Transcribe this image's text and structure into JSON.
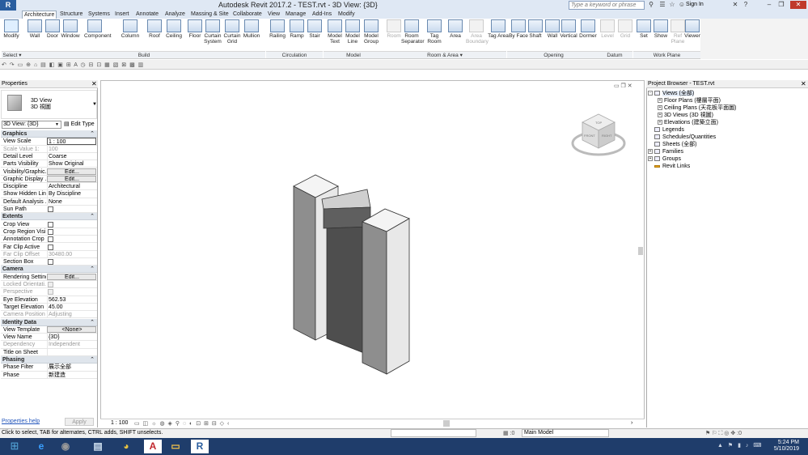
{
  "app": {
    "title": "Autodesk Revit 2017.2 -     TEST.rvt - 3D View: {3D}",
    "logo": "R"
  },
  "titlebar": {
    "search_placeholder": "Type a keyword or phrase",
    "sign_in": "Sign In"
  },
  "tabs": [
    "Architecture",
    "Structure",
    "Systems",
    "Insert",
    "Annotate",
    "Analyze",
    "Massing & Site",
    "Collaborate",
    "View",
    "Manage",
    "Add-Ins",
    "Modify"
  ],
  "ribbon": {
    "buttons": [
      {
        "name": "modify",
        "label": "Modify",
        "icon": "arrow-icon"
      },
      {
        "name": "wall",
        "label": "Wall",
        "icon": "wall-icon"
      },
      {
        "name": "door",
        "label": "Door",
        "icon": "door-icon"
      },
      {
        "name": "window",
        "label": "Window",
        "icon": "window-icon"
      },
      {
        "name": "component",
        "label": "Component",
        "icon": "component-icon"
      },
      {
        "name": "column",
        "label": "Column",
        "icon": "column-icon"
      },
      {
        "name": "roof",
        "label": "Roof",
        "icon": "roof-icon"
      },
      {
        "name": "ceiling",
        "label": "Ceiling",
        "icon": "ceiling-icon"
      },
      {
        "name": "floor",
        "label": "Floor",
        "icon": "floor-icon"
      },
      {
        "name": "curtain-system",
        "label": "Curtain System",
        "icon": "curtain-system-icon"
      },
      {
        "name": "curtain-grid",
        "label": "Curtain Grid",
        "icon": "curtain-grid-icon"
      },
      {
        "name": "mullion",
        "label": "Mullion",
        "icon": "mullion-icon"
      },
      {
        "name": "railing",
        "label": "Railing",
        "icon": "railing-icon"
      },
      {
        "name": "ramp",
        "label": "Ramp",
        "icon": "ramp-icon"
      },
      {
        "name": "stair",
        "label": "Stair",
        "icon": "stair-icon"
      },
      {
        "name": "model-text",
        "label": "Model Text",
        "icon": "model-text-icon"
      },
      {
        "name": "model-line",
        "label": "Model Line",
        "icon": "model-line-icon"
      },
      {
        "name": "model-group",
        "label": "Model Group",
        "icon": "model-group-icon"
      },
      {
        "name": "room",
        "label": "Room",
        "icon": "room-icon",
        "disabled": true
      },
      {
        "name": "room-separator",
        "label": "Room Separator",
        "icon": "room-separator-icon"
      },
      {
        "name": "tag-room",
        "label": "Tag Room",
        "icon": "tag-room-icon"
      },
      {
        "name": "area",
        "label": "Area",
        "icon": "area-icon"
      },
      {
        "name": "area-boundary",
        "label": "Area Boundary",
        "icon": "area-boundary-icon",
        "disabled": true
      },
      {
        "name": "tag-area",
        "label": "Tag Area",
        "icon": "tag-area-icon"
      },
      {
        "name": "by-face",
        "label": "By Face",
        "icon": "by-face-icon"
      },
      {
        "name": "shaft",
        "label": "Shaft",
        "icon": "shaft-icon"
      },
      {
        "name": "wall-opening",
        "label": "Wall",
        "icon": "wall-opening-icon"
      },
      {
        "name": "vertical",
        "label": "Vertical",
        "icon": "vertical-icon"
      },
      {
        "name": "dormer",
        "label": "Dormer",
        "icon": "dormer-icon"
      },
      {
        "name": "level",
        "label": "Level",
        "icon": "level-icon",
        "disabled": true
      },
      {
        "name": "grid",
        "label": "Grid",
        "icon": "grid-icon",
        "disabled": true
      },
      {
        "name": "set",
        "label": "Set",
        "icon": "set-icon"
      },
      {
        "name": "show",
        "label": "Show",
        "icon": "show-icon"
      },
      {
        "name": "ref-plane",
        "label": "Ref Plane",
        "icon": "ref-plane-icon",
        "disabled": true
      },
      {
        "name": "viewer",
        "label": "Viewer",
        "icon": "viewer-icon"
      }
    ],
    "panels": [
      "Build",
      "Circulation",
      "Model",
      "Room & Area ▾",
      "Opening",
      "Datum",
      "Work Plane"
    ],
    "select_label": "Select ▾"
  },
  "properties": {
    "title": "Properties",
    "type_name": "3D View",
    "type_sub": "3D 視圖",
    "view_selector": "3D View: {3D}",
    "edit_type": "Edit Type",
    "sections": [
      {
        "title": "Graphics",
        "rows": [
          {
            "label": "View Scale",
            "value": "1 : 100",
            "kind": "box"
          },
          {
            "label": "Scale Value    1:",
            "value": "100",
            "dim": true
          },
          {
            "label": "Detail Level",
            "value": "Coarse"
          },
          {
            "label": "Parts Visibility",
            "value": "Show Original"
          },
          {
            "label": "Visibility/Graphic...",
            "value": "Edit...",
            "kind": "button"
          },
          {
            "label": "Graphic Display ...",
            "value": "Edit...",
            "kind": "button"
          },
          {
            "label": "Discipline",
            "value": "Architectural"
          },
          {
            "label": "Show Hidden Lin...",
            "value": "By Discipline"
          },
          {
            "label": "Default Analysis ...",
            "value": "None"
          },
          {
            "label": "Sun Path",
            "value": "",
            "kind": "check"
          }
        ]
      },
      {
        "title": "Extents",
        "rows": [
          {
            "label": "Crop View",
            "value": "",
            "kind": "check"
          },
          {
            "label": "Crop Region Visi...",
            "value": "",
            "kind": "check"
          },
          {
            "label": "Annotation Crop",
            "value": "",
            "kind": "check"
          },
          {
            "label": "Far Clip Active",
            "value": "",
            "kind": "check"
          },
          {
            "label": "Far Clip Offset",
            "value": "30480.00",
            "dim": true
          },
          {
            "label": "Section Box",
            "value": "",
            "kind": "check"
          }
        ]
      },
      {
        "title": "Camera",
        "rows": [
          {
            "label": "Rendering Settings",
            "value": "Edit...",
            "kind": "button"
          },
          {
            "label": "Locked Orientati...",
            "value": "",
            "kind": "check",
            "dim": true
          },
          {
            "label": "Perspective",
            "value": "",
            "kind": "check",
            "dim": true
          },
          {
            "label": "Eye Elevation",
            "value": "562.53"
          },
          {
            "label": "Target Elevation",
            "value": "45.00"
          },
          {
            "label": "Camera Position",
            "value": "Adjusting",
            "dim": true
          }
        ]
      },
      {
        "title": "Identity Data",
        "rows": [
          {
            "label": "View Template",
            "value": "<None>",
            "kind": "button"
          },
          {
            "label": "View Name",
            "value": "{3D}"
          },
          {
            "label": "Dependency",
            "value": "Independent",
            "dim": true
          },
          {
            "label": "Title on Sheet",
            "value": ""
          }
        ]
      },
      {
        "title": "Phasing",
        "rows": [
          {
            "label": "Phase Filter",
            "value": "展示全部"
          },
          {
            "label": "Phase",
            "value": "新建造"
          }
        ]
      }
    ],
    "help_link": "Properties help",
    "apply": "Apply"
  },
  "canvas": {
    "scale": "1 : 100",
    "viewcube_faces": [
      "TOP",
      "FRONT",
      "RIGHT"
    ]
  },
  "browser": {
    "title": "Project Browser - TEST.rvt",
    "tree": [
      {
        "label": "Views (全部)",
        "level": 0,
        "exp": "-",
        "icon": "views-icon",
        "highlight": true
      },
      {
        "label": "Floor Plans (樓層平面)",
        "level": 1,
        "exp": "+"
      },
      {
        "label": "Ceiling Plans (天花板平面圖)",
        "level": 1,
        "exp": "+"
      },
      {
        "label": "3D Views (3D 視圖)",
        "level": 1,
        "exp": "+"
      },
      {
        "label": "Elevations (建築立面)",
        "level": 1,
        "exp": "+"
      },
      {
        "label": "Legends",
        "level": 0,
        "exp": "",
        "icon": "legends-icon"
      },
      {
        "label": "Schedules/Quantities",
        "level": 0,
        "exp": "",
        "icon": "schedules-icon"
      },
      {
        "label": "Sheets (全部)",
        "level": 0,
        "exp": "",
        "icon": "sheets-icon"
      },
      {
        "label": "Families",
        "level": 0,
        "exp": "+",
        "icon": "families-icon"
      },
      {
        "label": "Groups",
        "level": 0,
        "exp": "+",
        "icon": "groups-icon"
      },
      {
        "label": "Revit Links",
        "level": 0,
        "exp": "",
        "icon": "revit-links-icon"
      }
    ]
  },
  "status": {
    "text": "Click to select, TAB for alternates, CTRL adds, SHIFT unselects.",
    "model": "Main Model",
    "filter_count": ":0"
  },
  "taskbar": {
    "time": "5:24 PM",
    "date": "5/10/2019",
    "apps": [
      "IE",
      "Media",
      "Notepad",
      "Chrome",
      "AutoCAD",
      "Explorer",
      "Revit",
      "PDF"
    ]
  }
}
